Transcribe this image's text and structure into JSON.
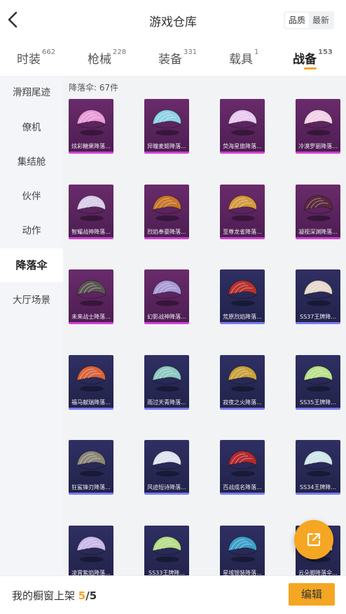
{
  "header": {
    "title": "游戏仓库",
    "back_icon": "chevron-left-icon",
    "sort_options": [
      "品质",
      "最新"
    ],
    "sort_selected": "品质"
  },
  "tabs": [
    {
      "label": "时装",
      "count": "662"
    },
    {
      "label": "枪械",
      "count": "228"
    },
    {
      "label": "装备",
      "count": "331"
    },
    {
      "label": "载具",
      "count": "1"
    },
    {
      "label": "战备",
      "count": "153"
    }
  ],
  "active_tab": "战备",
  "sidebar": {
    "items": [
      {
        "label": "滑翔尾迹"
      },
      {
        "label": "僚机"
      },
      {
        "label": "集结舱"
      },
      {
        "label": "伙伴"
      },
      {
        "label": "动作"
      },
      {
        "label": "降落伞"
      },
      {
        "label": "大厅场景"
      }
    ],
    "active": "降落伞"
  },
  "content": {
    "count_label": "降落伞: 67件",
    "items": [
      {
        "name": "炫彩糖果降落...",
        "rarity": "purple",
        "color": "#e99bd8"
      },
      {
        "name": "异瞳麦姬降落...",
        "rarity": "purple",
        "color": "#8fd2e6"
      },
      {
        "name": "荧海星旅降落...",
        "rarity": "purple",
        "color": "#e7c9f0"
      },
      {
        "name": "冷漠罗丽降落...",
        "rarity": "purple",
        "color": "#f2d0e6"
      },
      {
        "name": "智耀战神降落...",
        "rarity": "purple",
        "color": "#d9cde8"
      },
      {
        "name": "烈焰奉豪降落...",
        "rarity": "purple",
        "color": "#c8762a"
      },
      {
        "name": "至尊龙雀降落...",
        "rarity": "purple",
        "color": "#d49a3c"
      },
      {
        "name": "凝视深渊降落...",
        "rarity": "purple",
        "color": "#5a2a3e"
      },
      {
        "name": "未来战士降落...",
        "rarity": "purple",
        "color": "#5b5552"
      },
      {
        "name": "幻影战神降落...",
        "rarity": "purple",
        "color": "#a89bd4"
      },
      {
        "name": "荒原烈焰降落...",
        "rarity": "blue",
        "color": "#b8322e"
      },
      {
        "name": "SS37王牌降...",
        "rarity": "blue",
        "color": "#e6d8cc"
      },
      {
        "name": "福马献瑞降落...",
        "rarity": "blue",
        "color": "#d8643c"
      },
      {
        "name": "雨过天青降落...",
        "rarity": "blue",
        "color": "#8fc9c2"
      },
      {
        "name": "寂夜之火降落...",
        "rarity": "blue",
        "color": "#c8a23c"
      },
      {
        "name": "SS35王牌降...",
        "rarity": "blue",
        "color": "#b9e08c"
      },
      {
        "name": "狂鲨锋刃降落...",
        "rarity": "blue",
        "color": "#8c8678"
      },
      {
        "name": "风迹短诗降落...",
        "rarity": "blue",
        "color": "#dfe3ef"
      },
      {
        "name": "百战成名降落...",
        "rarity": "blue",
        "color": "#b42a2e"
      },
      {
        "name": "SS34王牌降...",
        "rarity": "blue",
        "color": "#cfe6ec"
      },
      {
        "name": "凌霄紫焰降落...",
        "rarity": "blue",
        "color": "#c9b8e8"
      },
      {
        "name": "SS33王牌降...",
        "rarity": "blue",
        "color": "#b6dd8a"
      },
      {
        "name": "星域银装降落...",
        "rarity": "blue",
        "color": "#3ea0c8"
      },
      {
        "name": "云朵脚降落伞...",
        "rarity": "blue",
        "color": "#ebe3f0"
      }
    ]
  },
  "share_icon": "share-external-icon",
  "bottom": {
    "showcase_label": "我的橱窗上架",
    "showcase_count": "5",
    "showcase_total": "/5",
    "edit_label": "编辑"
  },
  "colors": {
    "accent": "#f5a623",
    "purple_rarity": "#d33fd3",
    "blue_rarity": "#7b7bf0"
  }
}
